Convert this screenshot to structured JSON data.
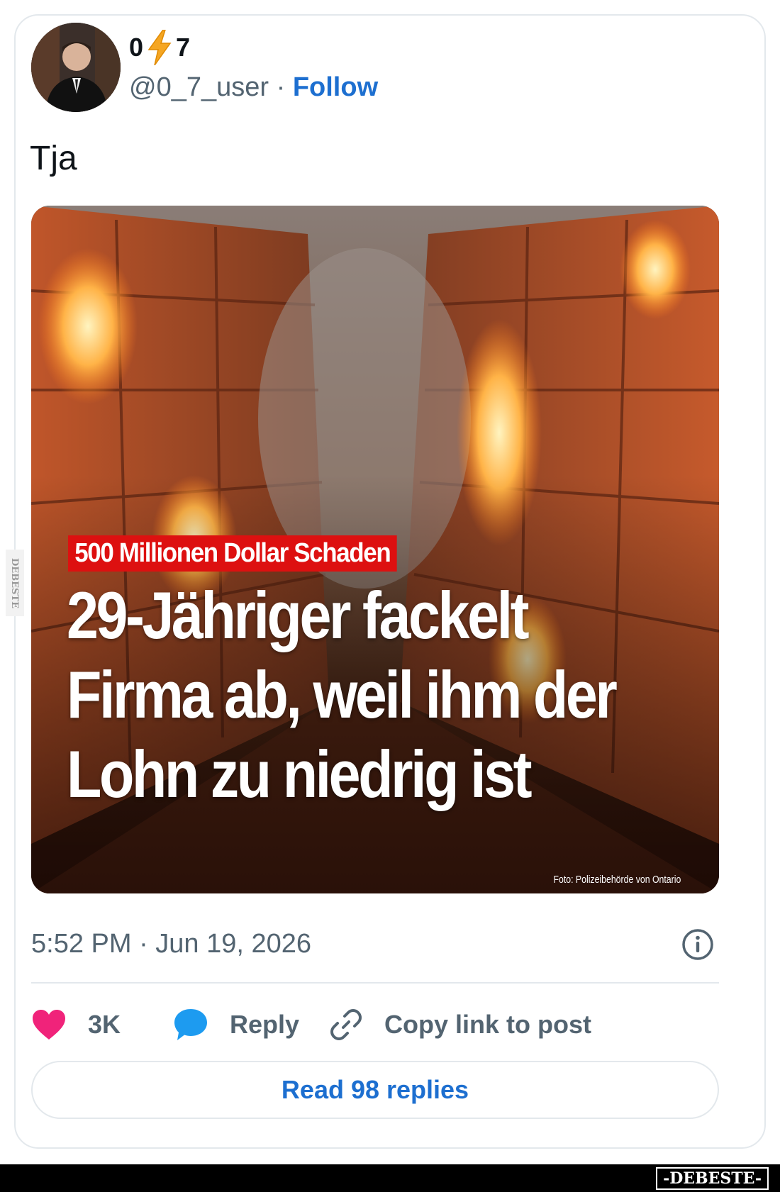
{
  "post": {
    "author": {
      "display_name_left": "0",
      "display_name_right": "7",
      "emoji": "lightning-emoji"
    },
    "handle": "@0_7_user",
    "separator": " · ",
    "follow_label": "Follow",
    "text": "Tja",
    "media": {
      "kicker": "500 Millionen Dollar Schaden",
      "headline_line1": "29-Jähriger fackelt",
      "headline_line2": "Firma ab, weil ihm der",
      "headline_line3": "Lohn zu niedrig ist",
      "credit": "Foto: Polizeibehörde von Ontario"
    },
    "timestamp": "5:52 PM · Jun 19, 2026",
    "info_icon": "info-icon",
    "actions": {
      "like_count": "3K",
      "reply_label": "Reply",
      "copy_label": "Copy link to post"
    },
    "read_replies_label": "Read 98 replies"
  },
  "watermark": {
    "badge": "-DEBESTE-",
    "side": "DEBESTE"
  },
  "colors": {
    "accent": "#1d6fd0",
    "like": "#f0237a",
    "reply_icon": "#1d9bf0",
    "kicker_bg": "#dd1010",
    "text_secondary": "#536471"
  }
}
